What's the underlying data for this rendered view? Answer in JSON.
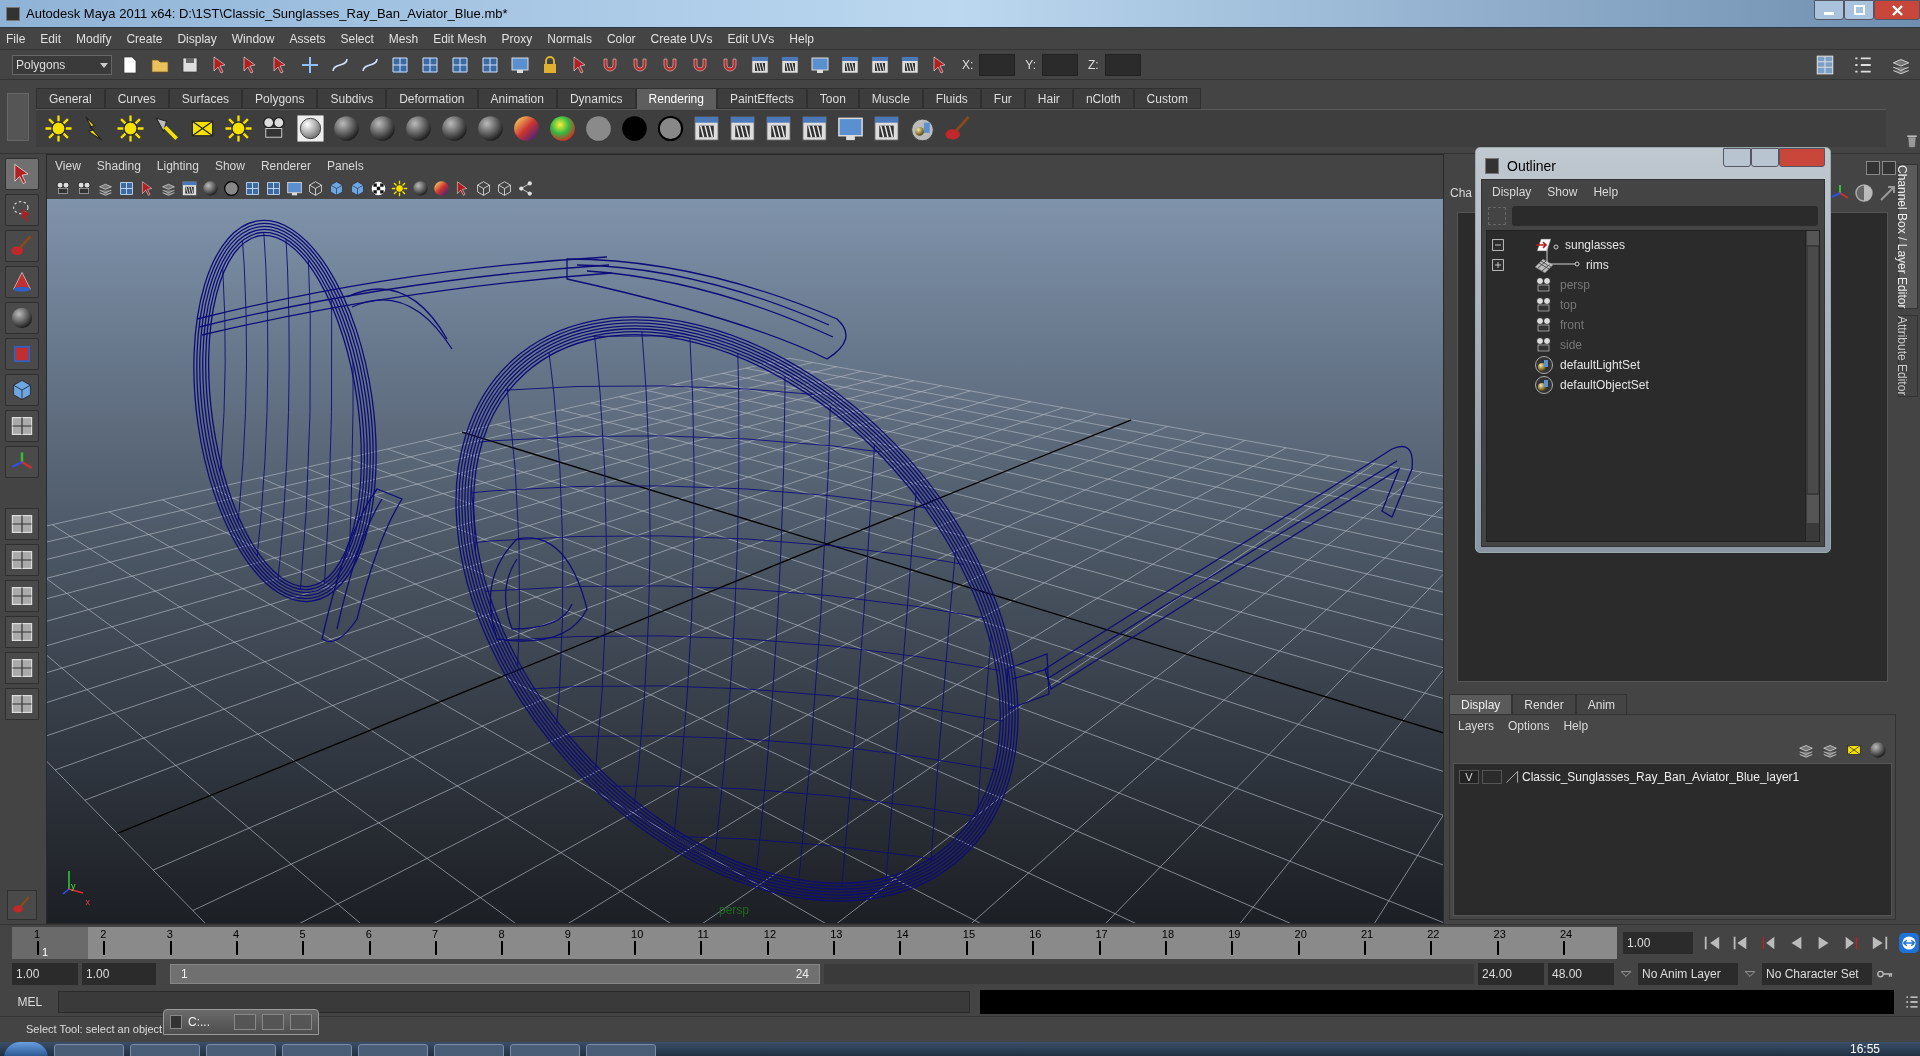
{
  "window": {
    "title": "Autodesk Maya 2011 x64: D:\\1ST\\Classic_Sunglasses_Ray_Ban_Aviator_Blue.mb*"
  },
  "menu_bar": [
    "File",
    "Edit",
    "Modify",
    "Create",
    "Display",
    "Window",
    "Assets",
    "Select",
    "Mesh",
    "Edit Mesh",
    "Proxy",
    "Normals",
    "Color",
    "Create UVs",
    "Edit UVs",
    "Help"
  ],
  "status_line": {
    "mode": "Polygons",
    "coord_labels": [
      "X:",
      "Y:",
      "Z:"
    ]
  },
  "shelf_tabs": [
    {
      "label": "General",
      "selected": false
    },
    {
      "label": "Curves",
      "selected": false
    },
    {
      "label": "Surfaces",
      "selected": false
    },
    {
      "label": "Polygons",
      "selected": false
    },
    {
      "label": "Subdivs",
      "selected": false
    },
    {
      "label": "Deformation",
      "selected": false
    },
    {
      "label": "Animation",
      "selected": false
    },
    {
      "label": "Dynamics",
      "selected": false
    },
    {
      "label": "Rendering",
      "selected": true
    },
    {
      "label": "PaintEffects",
      "selected": false
    },
    {
      "label": "Toon",
      "selected": false
    },
    {
      "label": "Muscle",
      "selected": false
    },
    {
      "label": "Fluids",
      "selected": false
    },
    {
      "label": "Fur",
      "selected": false
    },
    {
      "label": "Hair",
      "selected": false
    },
    {
      "label": "nCloth",
      "selected": false
    },
    {
      "label": "Custom",
      "selected": false
    }
  ],
  "viewport": {
    "menus": [
      "View",
      "Shading",
      "Lighting",
      "Show",
      "Renderer",
      "Panels"
    ],
    "camera": "persp",
    "axis_labels": [
      "y",
      "x"
    ]
  },
  "channel_box": {
    "tab": "Cha"
  },
  "side_tabs": [
    {
      "label": "Channel Box / Layer Editor",
      "selected": true
    },
    {
      "label": "Attribute Editor",
      "selected": false
    }
  ],
  "outliner": {
    "title": "Outliner",
    "menus": [
      "Display",
      "Show",
      "Help"
    ],
    "items": [
      {
        "label": "sunglasses",
        "kind": "transform",
        "expanded": true,
        "dimmed": false,
        "children": [
          {
            "label": "rims",
            "kind": "mesh",
            "expanded": false,
            "dimmed": false
          }
        ]
      },
      {
        "label": "persp",
        "kind": "camera",
        "dimmed": true
      },
      {
        "label": "top",
        "kind": "camera",
        "dimmed": true
      },
      {
        "label": "front",
        "kind": "camera",
        "dimmed": true
      },
      {
        "label": "side",
        "kind": "camera",
        "dimmed": true
      },
      {
        "label": "defaultLightSet",
        "kind": "set",
        "dimmed": false
      },
      {
        "label": "defaultObjectSet",
        "kind": "set",
        "dimmed": false
      }
    ]
  },
  "layer_editor": {
    "tabs": [
      {
        "label": "Display",
        "selected": true
      },
      {
        "label": "Render",
        "selected": false
      },
      {
        "label": "Anim",
        "selected": false
      }
    ],
    "menus": [
      "Layers",
      "Options",
      "Help"
    ],
    "layers": [
      {
        "visibility": "V",
        "name": "Classic_Sunglasses_Ray_Ban_Aviator_Blue_layer1"
      }
    ]
  },
  "timeline": {
    "ticks": [
      "1",
      "2",
      "3",
      "4",
      "5",
      "6",
      "7",
      "8",
      "9",
      "10",
      "11",
      "12",
      "13",
      "14",
      "15",
      "16",
      "17",
      "18",
      "19",
      "20",
      "21",
      "22",
      "23",
      "24"
    ],
    "current_frame": "1",
    "level": 0,
    "current_time": "1.00"
  },
  "range": {
    "start": "1.00",
    "range_start": "1.00",
    "slider_start": "1",
    "slider_end": "24",
    "range_end": "24.00",
    "end": "48.00",
    "anim_layer": "No Anim Layer",
    "character_set": "No Character Set"
  },
  "command_line": {
    "label": "MEL"
  },
  "help_line": "Select Tool: select an object",
  "mini_window": {
    "title": "C:..."
  },
  "taskbar": {
    "clock": "16:55"
  }
}
